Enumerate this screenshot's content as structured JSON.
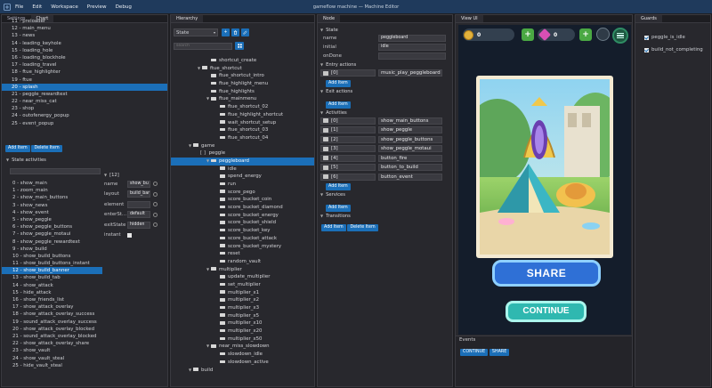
{
  "app": {
    "title": "gameflow machine — Machine Editor",
    "menu": [
      "File",
      "Edit",
      "Workspace",
      "Preview",
      "Debug"
    ]
  },
  "left_panel": {
    "tabs": [
      "Settings",
      "Chart"
    ],
    "states": [
      "11 - preloader",
      "12 - main_menu",
      "13 - news",
      "14 - leading_keyhole",
      "15 - loading_hole",
      "16 - loading_blockhole",
      "17 - loading_travel",
      "18 - ftue_highlighter",
      "19 - ftue",
      "20 - splash",
      "21 - peggle_rewardtext",
      "22 - near_miss_cat",
      "23 - shop",
      "24 - outofenergy_popup",
      "25 - event_popup"
    ],
    "selected_state_index": 9,
    "add_item": "Add Item",
    "delete_item": "Delete Item",
    "state_activities_title": "State activities",
    "activities": [
      "0 - show_main",
      "1 - zoom_main",
      "2 - show_main_buttons",
      "3 - show_news",
      "4 - show_event",
      "5 - show_peggle",
      "6 - show_peggle_buttons",
      "7 - show_peggle_motaui",
      "8 - show_peggle_rewardtext",
      "9 - show_build",
      "10 - show_build_buttons",
      "11 - show_build_buttons_instant",
      "12 - show_build_banner",
      "13 - show_build_tab",
      "14 - show_attack",
      "15 - hide_attack",
      "16 - show_friends_list",
      "17 - show_attack_overlay",
      "18 - show_attack_overlay_success",
      "19 - sound_attack_overlay_success",
      "20 - show_attack_overlay_blocked",
      "21 - sound_attack_overlay_blocked",
      "22 - show_attack_overlay_share",
      "23 - show_vault",
      "24 - show_vault_steal",
      "25 - hide_vault_steal"
    ],
    "selected_activity_index": 12,
    "item_header": "[12]",
    "item_props": [
      {
        "k": "name",
        "v": "show_bu"
      },
      {
        "k": "layout",
        "v": "build_bar"
      },
      {
        "k": "element",
        "v": ""
      },
      {
        "k": "enterSt...",
        "v": "default"
      },
      {
        "k": "exitState",
        "v": "hidden"
      },
      {
        "k": "instant",
        "v": ""
      }
    ]
  },
  "hierarchy": {
    "tab": "Hierarchy",
    "dropdown": "State",
    "search_placeholder": "search",
    "nodes": [
      {
        "label": "shortcut_create",
        "indent": 4,
        "type": "leaf"
      },
      {
        "label": "ftue_shortcut",
        "indent": 3,
        "type": "folder"
      },
      {
        "label": "ftue_shortcut_intro",
        "indent": 4,
        "type": "leaf"
      },
      {
        "label": "ftue_highlight_menu",
        "indent": 4,
        "type": "leaf"
      },
      {
        "label": "ftue_highlights",
        "indent": 4,
        "type": "leaf"
      },
      {
        "label": "ftue_mainmenu",
        "indent": 4,
        "type": "folder"
      },
      {
        "label": "ftue_shortcut_02",
        "indent": 5,
        "type": "leaf"
      },
      {
        "label": "ftue_highlight_shortcut",
        "indent": 5,
        "type": "leaf"
      },
      {
        "label": "wait_shortcut_setup",
        "indent": 5,
        "type": "leaf"
      },
      {
        "label": "ftue_shortcut_03",
        "indent": 5,
        "type": "leaf"
      },
      {
        "label": "ftue_shortcut_04",
        "indent": 5,
        "type": "leaf"
      },
      {
        "label": "game",
        "indent": 2,
        "type": "folder"
      },
      {
        "label": "peggle",
        "indent": 3,
        "type": "bracket"
      },
      {
        "label": "peggleboard",
        "indent": 4,
        "type": "folder",
        "selected": true
      },
      {
        "label": "idle",
        "indent": 5,
        "type": "leaf"
      },
      {
        "label": "spend_energy",
        "indent": 5,
        "type": "leaf"
      },
      {
        "label": "run",
        "indent": 5,
        "type": "leaf"
      },
      {
        "label": "score_pego",
        "indent": 5,
        "type": "leaf"
      },
      {
        "label": "score_bucket_coin",
        "indent": 5,
        "type": "leaf"
      },
      {
        "label": "score_bucket_diamond",
        "indent": 5,
        "type": "leaf"
      },
      {
        "label": "score_bucket_energy",
        "indent": 5,
        "type": "leaf"
      },
      {
        "label": "score_bucket_shield",
        "indent": 5,
        "type": "leaf"
      },
      {
        "label": "score_bucket_key",
        "indent": 5,
        "type": "leaf"
      },
      {
        "label": "score_bucket_attack",
        "indent": 5,
        "type": "leaf"
      },
      {
        "label": "score_bucket_mystery",
        "indent": 5,
        "type": "leaf"
      },
      {
        "label": "reset",
        "indent": 5,
        "type": "leaf"
      },
      {
        "label": "random_vault",
        "indent": 5,
        "type": "leaf"
      },
      {
        "label": "multiplier",
        "indent": 4,
        "type": "folder"
      },
      {
        "label": "update_multiplier",
        "indent": 5,
        "type": "leaf"
      },
      {
        "label": "set_multiplier",
        "indent": 5,
        "type": "leaf"
      },
      {
        "label": "multiplier_x1",
        "indent": 5,
        "type": "leaf"
      },
      {
        "label": "multiplier_x2",
        "indent": 5,
        "type": "leaf"
      },
      {
        "label": "multiplier_x3",
        "indent": 5,
        "type": "leaf"
      },
      {
        "label": "multiplier_x5",
        "indent": 5,
        "type": "leaf"
      },
      {
        "label": "multiplier_x10",
        "indent": 5,
        "type": "leaf"
      },
      {
        "label": "multiplier_x20",
        "indent": 5,
        "type": "leaf"
      },
      {
        "label": "multiplier_x50",
        "indent": 5,
        "type": "leaf"
      },
      {
        "label": "near_miss_slowdown",
        "indent": 4,
        "type": "folder"
      },
      {
        "label": "slowdown_idle",
        "indent": 5,
        "type": "leaf"
      },
      {
        "label": "slowdown_active",
        "indent": 5,
        "type": "leaf"
      },
      {
        "label": "build",
        "indent": 2,
        "type": "folder"
      }
    ]
  },
  "node": {
    "tab": "Node",
    "section_state": "State",
    "props": [
      {
        "k": "name",
        "v": "peggleboard"
      },
      {
        "k": "initial",
        "v": "idle"
      },
      {
        "k": "onDone",
        "v": ""
      }
    ],
    "entry_actions_title": "Entry actions",
    "entry_actions": [
      {
        "idx": "[0]",
        "name": "music_play_peggleboard"
      }
    ],
    "exit_actions_title": "Exit actions",
    "activities_title": "Activities",
    "activities": [
      {
        "idx": "[0]",
        "name": "show_main_buttons"
      },
      {
        "idx": "[1]",
        "name": "show_peggle"
      },
      {
        "idx": "[2]",
        "name": "show_peggle_buttons"
      },
      {
        "idx": "[3]",
        "name": "show_peggle_motaui"
      },
      {
        "idx": "[4]",
        "name": "button_fire"
      },
      {
        "idx": "[5]",
        "name": "button_to_build"
      },
      {
        "idx": "[6]",
        "name": "button_event"
      }
    ],
    "services_title": "Services",
    "transitions_title": "Transitions",
    "add_item": "Add Item",
    "delete_item": "Delete Item"
  },
  "view": {
    "tab": "View UI",
    "coins": "0",
    "gems": "0",
    "share": "SHARE",
    "continue": "CONTINUE",
    "events_title": "Events",
    "events": [
      "CONTINUE",
      "SHARE"
    ]
  },
  "guards": {
    "tab": "Guards",
    "items": [
      {
        "label": "peggle_is_idle",
        "checked": true
      },
      {
        "label": "build_not_completing",
        "checked": true
      }
    ]
  },
  "colors": {
    "accent": "#1b6fb8",
    "menubar": "#1f3a5c",
    "panel": "#28282d"
  }
}
